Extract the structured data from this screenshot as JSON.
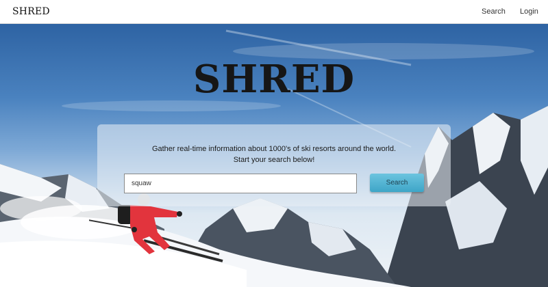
{
  "nav": {
    "brand": "SHRED",
    "links": [
      {
        "label": "Search"
      },
      {
        "label": "Login"
      }
    ]
  },
  "hero": {
    "title": "SHRED",
    "tagline_line1": "Gather real-time information about 1000's of ski resorts around the world.",
    "tagline_line2": "Start your search below!",
    "search": {
      "value": "squaw",
      "button_label": "Search"
    }
  },
  "colors": {
    "sky_top": "#2e63a3",
    "button": "#4fb3d3",
    "skier_suit": "#e2343d"
  }
}
